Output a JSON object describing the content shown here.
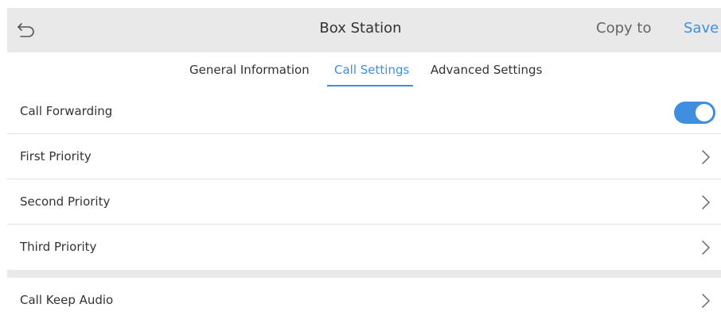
{
  "header": {
    "title": "Box Station",
    "copy_label": "Copy to",
    "save_label": "Save",
    "back_icon": "back-arrow-icon"
  },
  "tabs": [
    {
      "label": "General Information",
      "active": false
    },
    {
      "label": "Call Settings",
      "active": true
    },
    {
      "label": "Advanced Settings",
      "active": false
    }
  ],
  "settings": {
    "call_forwarding": {
      "label": "Call Forwarding",
      "enabled": true
    },
    "first_priority": {
      "label": "First Priority"
    },
    "second_priority": {
      "label": "Second Priority"
    },
    "third_priority": {
      "label": "Third Priority"
    },
    "call_keep_audio": {
      "label": "Call Keep Audio"
    }
  },
  "colors": {
    "accent": "#3f8ee0",
    "header_bg": "#e9e9e9",
    "divider": "#e3e3e3"
  }
}
